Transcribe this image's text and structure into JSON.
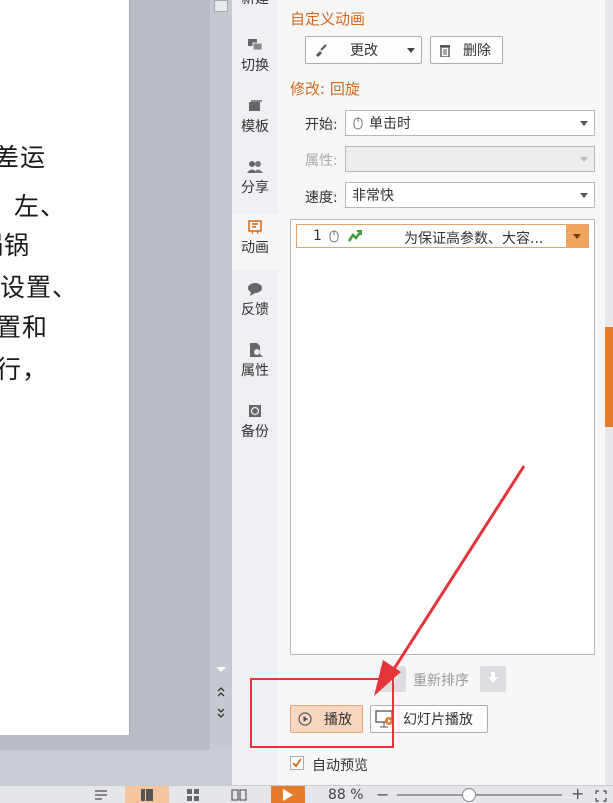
{
  "slide": {
    "text_lines": [
      "差运",
      "、左、",
      "锅锅",
      "设置、",
      "置和",
      "行，"
    ]
  },
  "side_tabs": [
    {
      "label": "新建",
      "icon": "new-icon"
    },
    {
      "label": "切换",
      "icon": "transition-icon"
    },
    {
      "label": "模板",
      "icon": "template-icon"
    },
    {
      "label": "分享",
      "icon": "share-icon"
    },
    {
      "label": "动画",
      "icon": "animation-icon",
      "active": true
    },
    {
      "label": "反馈",
      "icon": "feedback-icon"
    },
    {
      "label": "属性",
      "icon": "properties-icon"
    },
    {
      "label": "备份",
      "icon": "backup-icon"
    }
  ],
  "pane": {
    "title": "自定义动画",
    "change_button": "更改",
    "delete_button": "删除",
    "modify_heading": "修改: 回旋",
    "start_label": "开始:",
    "start_value": "单击时",
    "property_label": "属性:",
    "property_value": "",
    "speed_label": "速度:",
    "speed_value": "非常快",
    "anim_item": {
      "index": "1",
      "text": "为保证高参数、大容..."
    },
    "reorder_label": "重新排序",
    "play_button": "播放",
    "slideshow_button": "幻灯片播放",
    "autopreview_label": "自动预览",
    "autopreview_checked": true
  },
  "status_bar": {
    "zoom": "88 %"
  },
  "colors": {
    "accent": "#d2691e",
    "annotation": "#e5353a",
    "play_highlight": "#f8d6bf"
  }
}
